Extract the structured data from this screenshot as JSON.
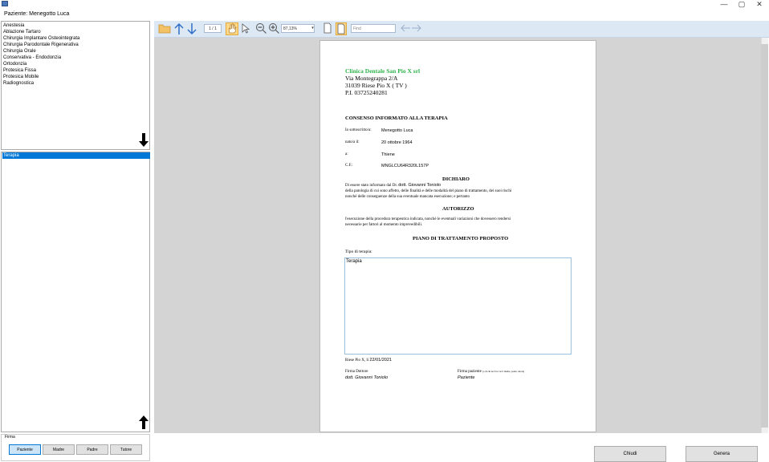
{
  "window": {
    "app_icon": "window-icon",
    "patient_label": "Paziente: Menegotto Luca",
    "controls": {
      "minimize": "—",
      "maximize": "▢",
      "close": "✕"
    }
  },
  "categories": [
    "Anestesia",
    "Ablazione Tartaro",
    "Chirurgia Implantare Osteointegrata",
    "Chirurgia Parodontale Rigenerativa",
    "Chirurgia Orale",
    "Conservativa - Endodonzia",
    "Ortodonzia",
    "Protesica Fissa",
    "Protesica Mobile",
    "Radiognostica"
  ],
  "selected_items": [
    "Terapia"
  ],
  "arrows": {
    "down": "🠗",
    "up": "🠕"
  },
  "firma": {
    "title": "Firma",
    "buttons": [
      "Paziente",
      "Madre",
      "Padre",
      "Tutore"
    ]
  },
  "toolbar": {
    "page_indicator": "1 / 1",
    "zoom": "87,13%",
    "find_placeholder": "Find",
    "icons": [
      "open-folder-icon",
      "arrow-up-icon",
      "arrow-down-icon",
      "hand-tool-icon",
      "select-tool-icon",
      "zoom-out-icon",
      "zoom-in-icon",
      "single-page-icon",
      "facing-page-icon",
      "back-icon",
      "forward-icon"
    ]
  },
  "document": {
    "clinic_name": "Clinica Dentale San Pio X srl",
    "address1": "Via Montegrappa 2/A",
    "address2": "31039 Riese Pio X ( TV )",
    "piva": "P.I. 03725240281",
    "title": "CONSENSO INFORMATO ALLA TERAPIA",
    "fields": [
      {
        "label": "Io sottoscritto/a:",
        "value": "Menegotto Luca"
      },
      {
        "label": "nato/a il:",
        "value": "20 ottobre 1964"
      },
      {
        "label": "a:",
        "value": "Thiene"
      },
      {
        "label": "C.F.:",
        "value": "MNGLCU64R320L157P"
      }
    ],
    "dichiaro_heading": "DICHIARO",
    "dichiaro_line1_prefix": "Di essere stato informato dal Dr.",
    "doctor": "dott. Giovanni Toniolo",
    "dichiaro_line2": "della patologia di cui sono affetto, delle finalità e delle modalità del piano di trattamento, dei suoi rischi",
    "dichiaro_line3": "nonché delle conseguenze della sua eventuale mancata esecuzione; e pertanto",
    "autorizzo_heading": "AUTORIZZO",
    "autorizzo_line1": "l'esecuzione della procedura terapeutica indicata, nonché le eventuali variazioni che dovessero rendersi",
    "autorizzo_line2": "necessarie per fattori al momento imprevedibili.",
    "piano_heading": "PIANO DI TRATTAMENTO PROPOSTO",
    "tipo_label": "Tipo di terapia:",
    "therapy_text": "Terapia",
    "place_date_prefix": "Riese Pio X, lì",
    "date": "22/01/2021",
    "firma_dottore_label": "Firma Dottore",
    "firma_dottore_value": "dott. Giovanni Toniolo",
    "firma_paziente_label": "Firma paziente",
    "firma_paziente_note": "(o di chi ne fa le veci: madre, padre, tutore)",
    "firma_paziente_value": "Paziente"
  },
  "buttons": {
    "close": "Chiudi",
    "generate": "Genera"
  }
}
